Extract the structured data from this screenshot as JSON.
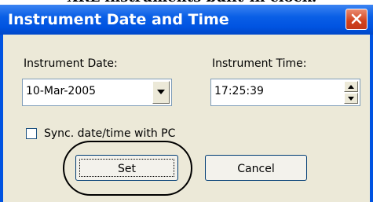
{
  "doc": {
    "heading": "- XRL instruments built-in clock."
  },
  "window": {
    "title": "Instrument Date and Time"
  },
  "date": {
    "label": "Instrument Date:",
    "value": "10-Mar-2005"
  },
  "time": {
    "label": "Instrument Time:",
    "value": "17:25:39"
  },
  "sync": {
    "label": "Sync. date/time with PC",
    "checked": false
  },
  "buttons": {
    "set": "Set",
    "cancel": "Cancel"
  },
  "colors": {
    "titlebar": "#0053e1",
    "close": "#d1421d",
    "face": "#ece9d8"
  }
}
